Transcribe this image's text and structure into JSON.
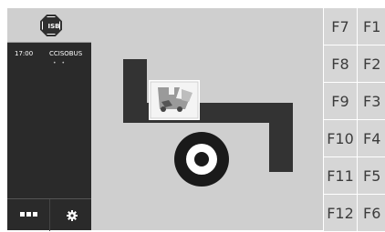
{
  "sidebar": {
    "isb_label": "ISB",
    "clock": "17:00",
    "vt_name": "CCISOBUS",
    "vt_indicator": "• •",
    "more_icon": "more-dots-icon",
    "settings_icon": "gear-icon"
  },
  "main": {
    "logo": "tractor-implement-logo",
    "implement_icon": "implement-image-icon"
  },
  "softkeys": {
    "left": [
      "F7",
      "F8",
      "F9",
      "F10",
      "F11",
      "F12"
    ],
    "right": [
      "F1",
      "F2",
      "F3",
      "F4",
      "F5",
      "F6"
    ]
  },
  "colors": {
    "sidebar_bg": "#2a2a2a",
    "main_bg": "#cfcfcf",
    "logo": "#333333",
    "softkey_bg": "#d6d6d6",
    "softkey_text": "#3c3c3c"
  }
}
